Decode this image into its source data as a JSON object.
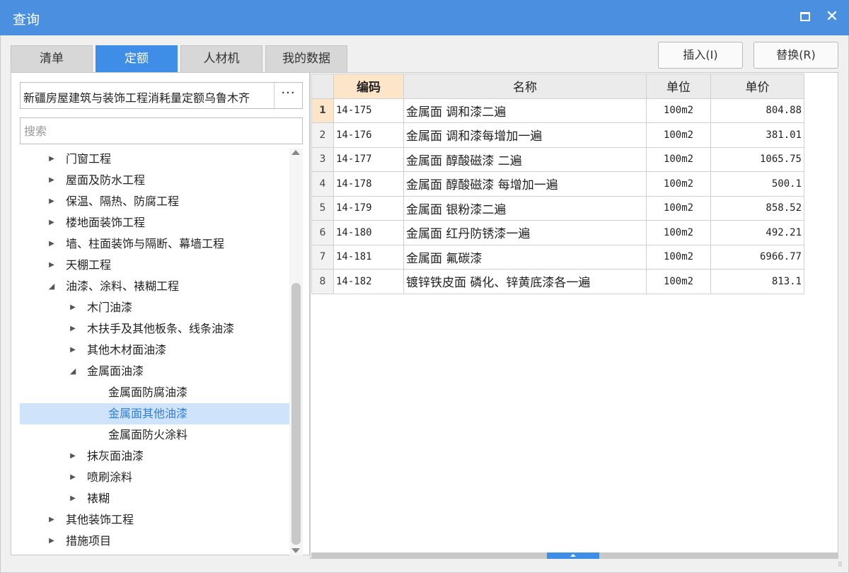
{
  "window": {
    "title": "查询",
    "maximize_icon": "maximize-icon",
    "close_icon": "close-icon",
    "close_glyph": "✕"
  },
  "tabs": [
    {
      "label": "清单",
      "active": false
    },
    {
      "label": "定额",
      "active": true
    },
    {
      "label": "人材机",
      "active": false
    },
    {
      "label": "我的数据",
      "active": false
    }
  ],
  "actions": {
    "insert_label": "插入(I)",
    "replace_label": "替换(R)"
  },
  "library": {
    "name": "新疆房屋建筑与装饰工程消耗量定额乌鲁木齐",
    "more_label": "···"
  },
  "search": {
    "placeholder": "搜索",
    "value": ""
  },
  "tree": [
    {
      "label": "门窗工程",
      "level": 1,
      "expander": "collapsed"
    },
    {
      "label": "屋面及防水工程",
      "level": 1,
      "expander": "collapsed"
    },
    {
      "label": "保温、隔热、防腐工程",
      "level": 1,
      "expander": "collapsed"
    },
    {
      "label": "楼地面装饰工程",
      "level": 1,
      "expander": "collapsed"
    },
    {
      "label": "墙、柱面装饰与隔断、幕墙工程",
      "level": 1,
      "expander": "collapsed"
    },
    {
      "label": "天棚工程",
      "level": 1,
      "expander": "collapsed"
    },
    {
      "label": "油漆、涂料、裱糊工程",
      "level": 1,
      "expander": "expanded"
    },
    {
      "label": "木门油漆",
      "level": 2,
      "expander": "collapsed"
    },
    {
      "label": "木扶手及其他板条、线条油漆",
      "level": 2,
      "expander": "collapsed"
    },
    {
      "label": "其他木材面油漆",
      "level": 2,
      "expander": "collapsed"
    },
    {
      "label": "金属面油漆",
      "level": 2,
      "expander": "expanded"
    },
    {
      "label": "金属面防腐油漆",
      "level": 3,
      "expander": "none"
    },
    {
      "label": "金属面其他油漆",
      "level": 3,
      "expander": "none",
      "selected": true
    },
    {
      "label": "金属面防火涂料",
      "level": 3,
      "expander": "none"
    },
    {
      "label": "抹灰面油漆",
      "level": 2,
      "expander": "collapsed"
    },
    {
      "label": "喷刷涂料",
      "level": 2,
      "expander": "collapsed"
    },
    {
      "label": "裱糊",
      "level": 2,
      "expander": "collapsed"
    },
    {
      "label": "其他装饰工程",
      "level": 1,
      "expander": "collapsed"
    },
    {
      "label": "措施项目",
      "level": 1,
      "expander": "collapsed"
    }
  ],
  "grid": {
    "columns": [
      "编码",
      "名称",
      "单位",
      "单价"
    ],
    "current_row": 1,
    "rows": [
      {
        "no": "1",
        "code": "14-175",
        "name": "金属面 调和漆二遍",
        "unit": "100m2",
        "price": "804.88"
      },
      {
        "no": "2",
        "code": "14-176",
        "name": "金属面 调和漆每增加一遍",
        "unit": "100m2",
        "price": "381.01"
      },
      {
        "no": "3",
        "code": "14-177",
        "name": "金属面 醇酸磁漆 二遍",
        "unit": "100m2",
        "price": "1065.75"
      },
      {
        "no": "4",
        "code": "14-178",
        "name": "金属面 醇酸磁漆 每增加一遍",
        "unit": "100m2",
        "price": "500.1"
      },
      {
        "no": "5",
        "code": "14-179",
        "name": "金属面 银粉漆二遍",
        "unit": "100m2",
        "price": "858.52"
      },
      {
        "no": "6",
        "code": "14-180",
        "name": "金属面 红丹防锈漆一遍",
        "unit": "100m2",
        "price": "492.21"
      },
      {
        "no": "7",
        "code": "14-181",
        "name": "金属面 氟碳漆",
        "unit": "100m2",
        "price": "6966.77"
      },
      {
        "no": "8",
        "code": "14-182",
        "name": "镀锌铁皮面 磷化、锌黄底漆各一遍",
        "unit": "100m2",
        "price": "813.1"
      }
    ]
  },
  "colors": {
    "titlebar": "#4a8fe0",
    "active_tab": "#3e8ee8",
    "selected_tree_bg": "#cfe4fb",
    "selected_tree_text": "#2f7fd8",
    "current_cell": "#fce5c8"
  }
}
